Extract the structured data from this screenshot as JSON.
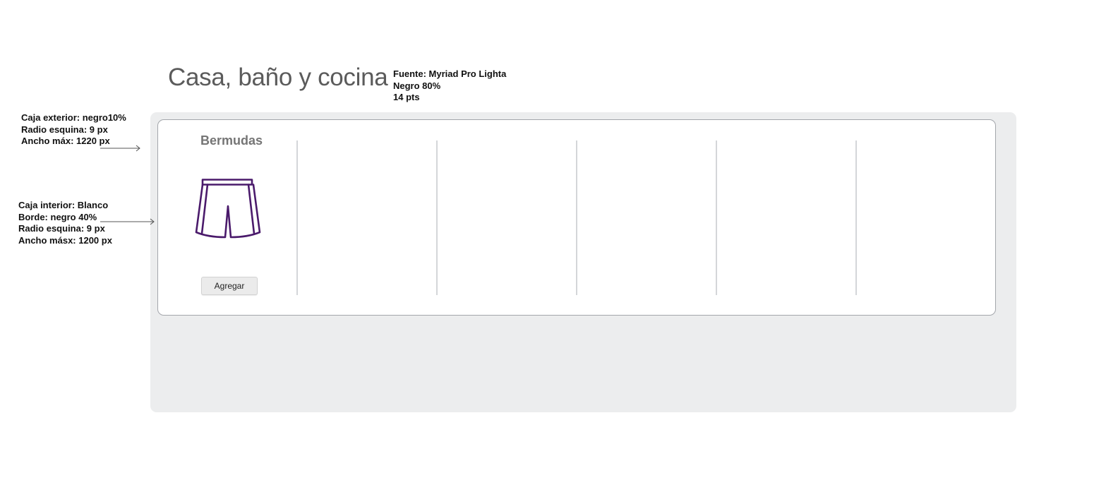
{
  "title": "Casa, baño y cocina",
  "font_spec": {
    "line1": "Fuente: Myriad Pro Lighta",
    "line2": "Negro 80%",
    "line3": "14 pts"
  },
  "outer_box_note": {
    "line1": "Caja exterior: negro10%",
    "line2": "Radio esquina: 9 px",
    "line3": "Ancho máx: 1220 px"
  },
  "inner_box_note": {
    "line1": "Caja interior: Blanco",
    "line2": "Borde: negro 40%",
    "line3": "Radio esquina: 9 px",
    "line4": "Ancho másx: 1200 px"
  },
  "product": {
    "name": "Bermudas",
    "icon": "shorts-icon",
    "icon_color": "#4a1a6b",
    "button_label": "Agregar"
  },
  "colors": {
    "outer_box": "#ecedee",
    "inner_border": "#a3a6ab",
    "title": "#5b5b5b",
    "product_name": "#757575"
  }
}
